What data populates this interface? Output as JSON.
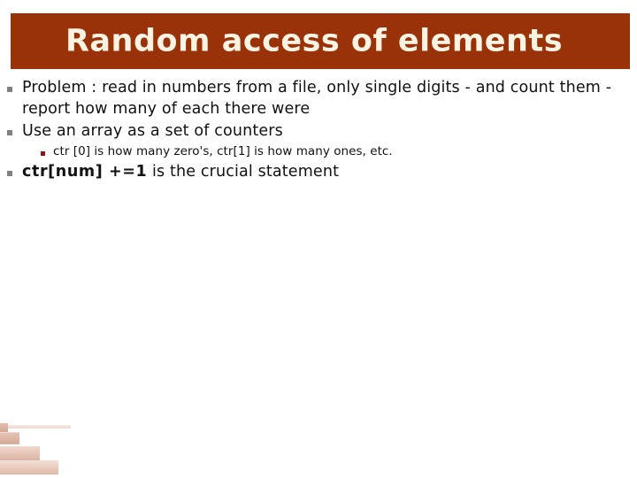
{
  "slide": {
    "title": "Random access of elements",
    "title_bar_color": "#9a3209",
    "title_text_color": "#fdf3e3",
    "background_color": "#ffffff",
    "body_text_color": "#111111",
    "bullet_marker_color": "#808080",
    "sub_bullet_marker_color": "#8a1616",
    "decoration_color": "#e0bbaa",
    "bullets": [
      {
        "level": 1,
        "text": "Problem : read in numbers from a file, only single digits - and count them - report how many of each there were"
      },
      {
        "level": 1,
        "text": "Use an array as a set of counters"
      },
      {
        "level": 2,
        "text": "ctr [0] is how many zero's, ctr[1] is how many ones, etc."
      },
      {
        "level": 1,
        "code": "ctr[num] +=1",
        "text": "  is the crucial statement"
      }
    ]
  }
}
